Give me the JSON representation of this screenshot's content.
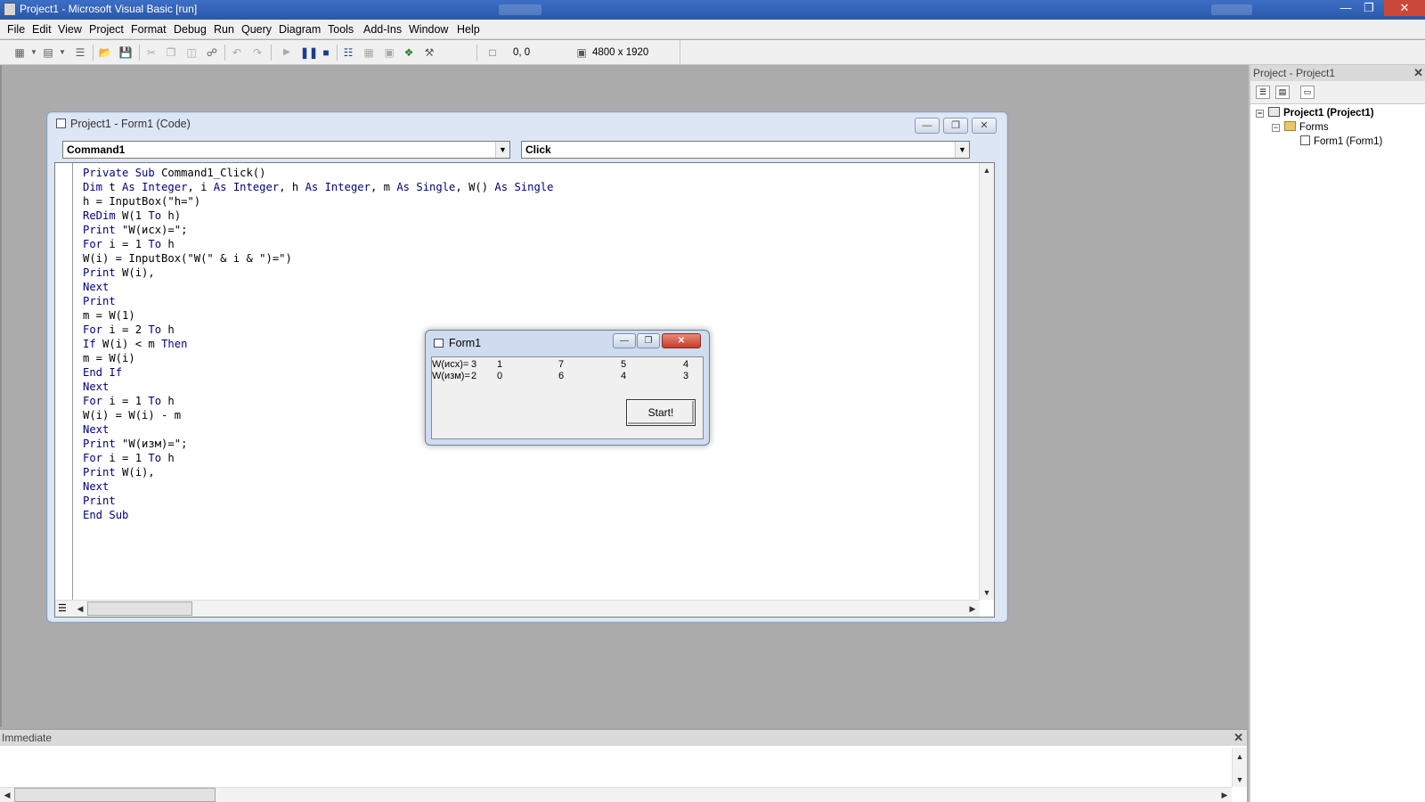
{
  "window": {
    "title": "Project1 - Microsoft Visual Basic [run]"
  },
  "menu": [
    "File",
    "Edit",
    "View",
    "Project",
    "Format",
    "Debug",
    "Run",
    "Query",
    "Diagram",
    "Tools",
    "Add-Ins",
    "Window",
    "Help"
  ],
  "toolbar": {
    "position": "0, 0",
    "size": "4800 x 1920"
  },
  "code_window": {
    "title": "Project1 - Form1 (Code)",
    "object_combo": "Command1",
    "procedure_combo": "Click",
    "lines": [
      "Private Sub Command1_Click()",
      "Dim t As Integer, i As Integer, h As Integer, m As Single, W() As Single",
      "h = InputBox(\"h=\")",
      "ReDim W(1 To h)",
      "Print \"W(исх)=\";",
      "For i = 1 To h",
      "W(i) = InputBox(\"W(\" & i & \")=\")",
      "Print W(i),",
      "Next",
      "Print",
      "m = W(1)",
      "For i = 2 To h",
      "If W(i) < m Then",
      "m = W(i)",
      "End If",
      "Next",
      "For i = 1 To h",
      "W(i) = W(i) - m",
      "Next",
      "Print \"W(изм)=\";",
      "For i = 1 To h",
      "Print W(i),",
      "Next",
      "Print",
      "End Sub"
    ]
  },
  "form1": {
    "title": "Form1",
    "rows": [
      {
        "label": "W(исх)=",
        "values": [
          "3",
          "1",
          "7",
          "5",
          "4"
        ]
      },
      {
        "label": "W(изм)=",
        "values": [
          "2",
          "0",
          "6",
          "4",
          "3"
        ]
      }
    ],
    "button_label": "Start!"
  },
  "project_panel": {
    "title": "Project - Project1",
    "root": "Project1 (Project1)",
    "folder": "Forms",
    "item": "Form1 (Form1)"
  },
  "immediate": {
    "title": "Immediate"
  }
}
